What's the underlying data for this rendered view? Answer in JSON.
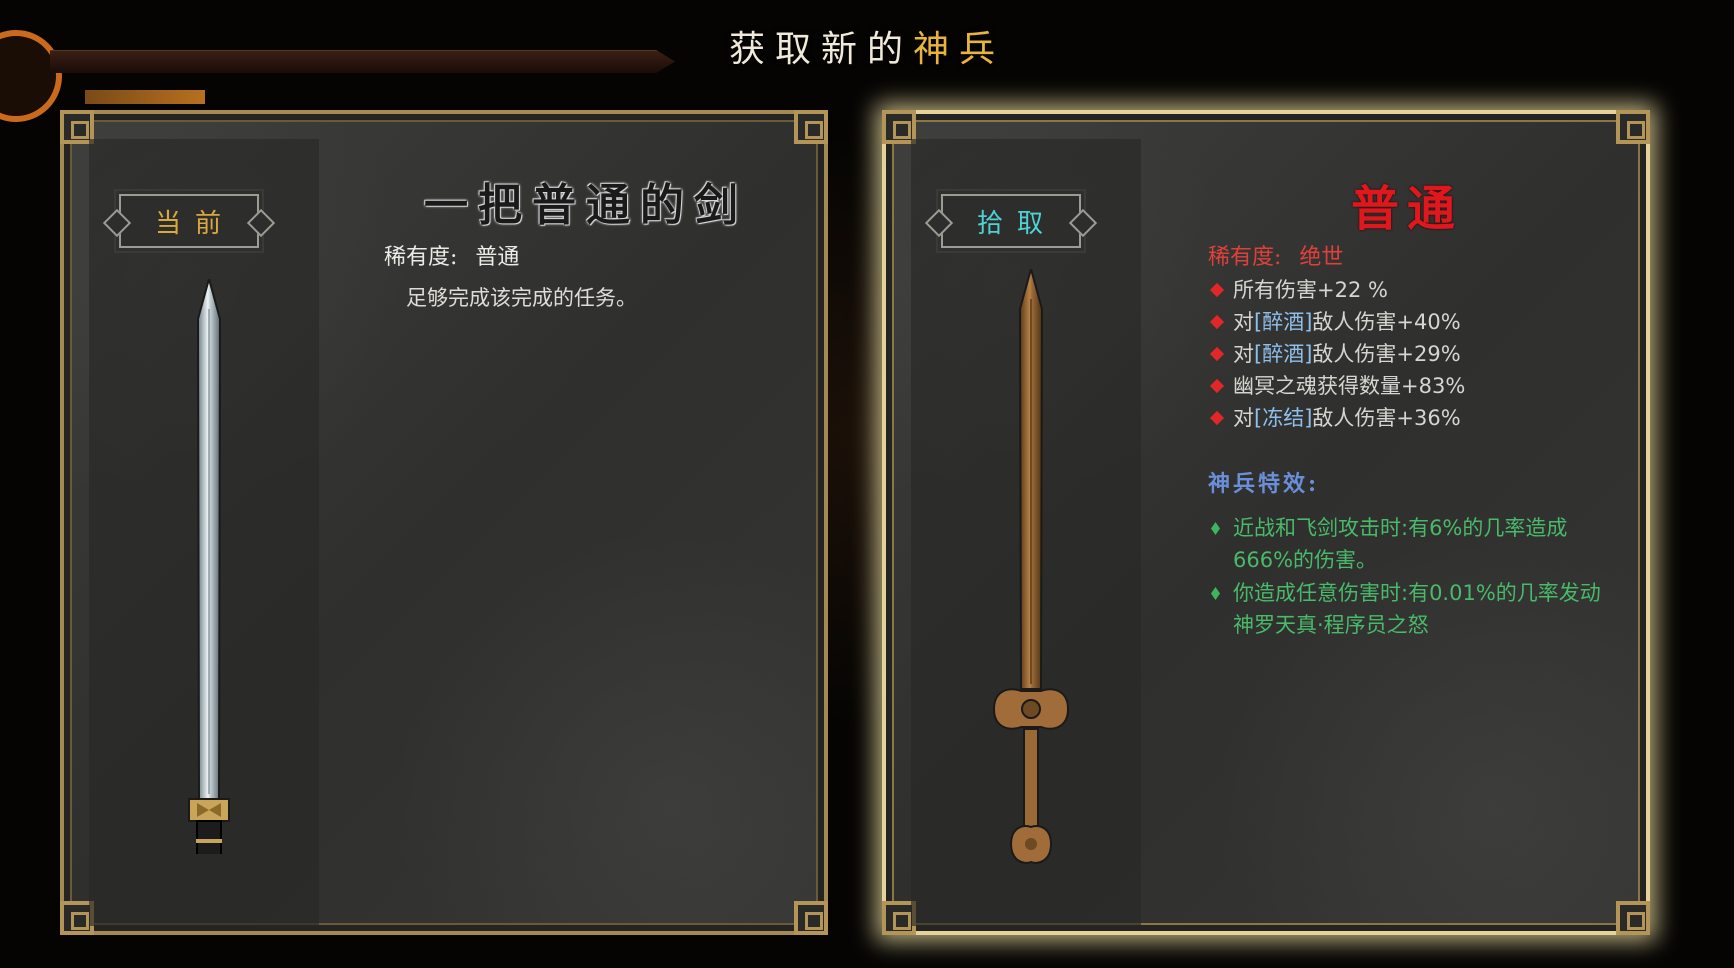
{
  "title": {
    "prefix": "获取新的",
    "accent": "神兵"
  },
  "current_card": {
    "badge": "当前",
    "name": "一把普通的剑",
    "rarity_label": "稀有度:",
    "rarity_value": "普通",
    "description": "足够完成该完成的任务。"
  },
  "pickup_card": {
    "badge": "拾取",
    "name": "普通",
    "rarity_label": "稀有度:",
    "rarity_value": "绝世",
    "stats": [
      {
        "pre": "所有伤害+22 %",
        "tag": "",
        "post": ""
      },
      {
        "pre": "对",
        "tag": "[醉酒]",
        "post": "敌人伤害+40%"
      },
      {
        "pre": "对",
        "tag": "[醉酒]",
        "post": "敌人伤害+29%"
      },
      {
        "pre": "幽冥之魂获得数量+83%",
        "tag": "",
        "post": ""
      },
      {
        "pre": "对",
        "tag": "[冻结]",
        "post": "敌人伤害+36%"
      }
    ],
    "special_title": "神兵特效:",
    "effects": [
      "近战和飞剑攻击时:有6%的几率造成666%的伤害。",
      "你造成任意伤害时:有0.01%的几率发动神罗天真·程序员之怒"
    ]
  },
  "colors": {
    "accent_gold": "#e8b43c",
    "rarity_red": "#e0181d",
    "effect_green": "#49b96a",
    "stat_diamond": "#e2262a",
    "special_blue": "#6a8fd8",
    "pickup_badge": "#4fd2d6",
    "frame_glow": "#f6e8aa"
  },
  "icons": {
    "current_weapon": "steel-sword-icon",
    "pickup_weapon": "bronze-sword-icon"
  }
}
